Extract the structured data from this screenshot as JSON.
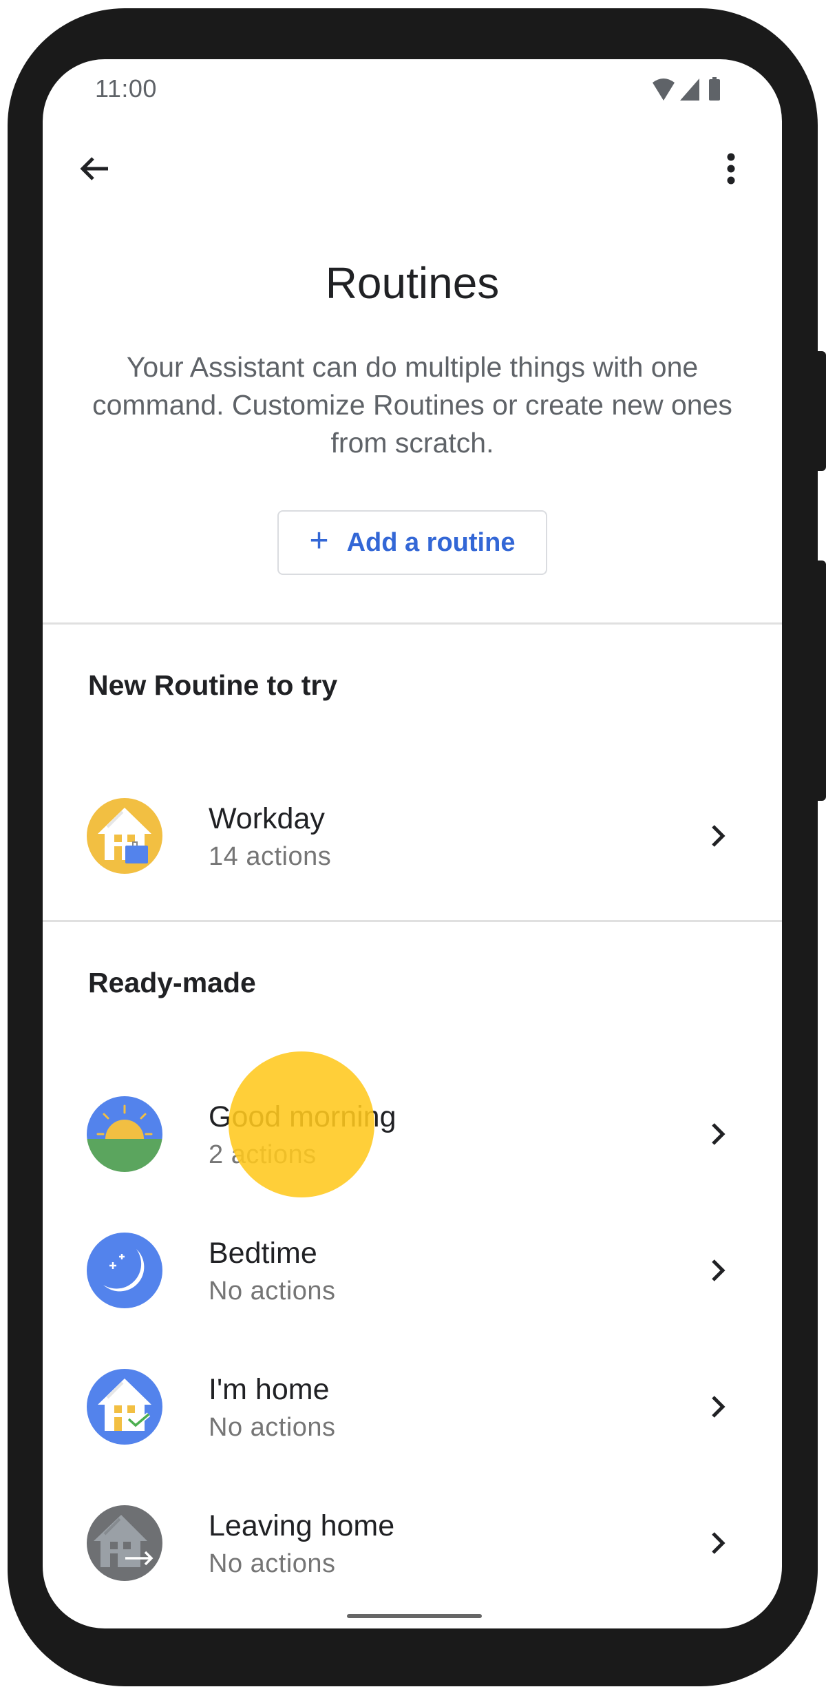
{
  "status_bar": {
    "time": "11:00",
    "icons": [
      "wifi-icon",
      "cell-signal-icon",
      "battery-icon"
    ]
  },
  "app_bar": {
    "back_icon": "arrow-back-icon",
    "more_icon": "more-vert-icon"
  },
  "header": {
    "title": "Routines",
    "description": "Your Assistant can do multiple things with one command. Customize Routines or create new ones from scratch.",
    "add_button": {
      "icon": "+",
      "label": "Add a routine"
    }
  },
  "sections": [
    {
      "heading": "New Routine to try",
      "items": [
        {
          "title": "Workday",
          "subtitle": "14 actions",
          "icon": "workday-house-briefcase-icon",
          "icon_color": "#F2BF42"
        }
      ]
    },
    {
      "heading": "Ready-made",
      "items": [
        {
          "title": "Good morning",
          "subtitle": "2 actions",
          "icon": "sunrise-icon",
          "icon_color": "#5383EC"
        },
        {
          "title": "Bedtime",
          "subtitle": "No actions",
          "icon": "moon-stars-icon",
          "icon_color": "#5383EC"
        },
        {
          "title": "I'm home",
          "subtitle": "No actions",
          "icon": "house-check-icon",
          "icon_color": "#5383EC"
        },
        {
          "title": "Leaving home",
          "subtitle": "No actions",
          "icon": "house-leave-icon",
          "icon_color": "#6E7073"
        }
      ]
    }
  ],
  "colors": {
    "accent": "#3367D6",
    "text_primary": "#202124",
    "text_secondary": "#5F6368",
    "touch_indicator": "#FFC81E"
  }
}
